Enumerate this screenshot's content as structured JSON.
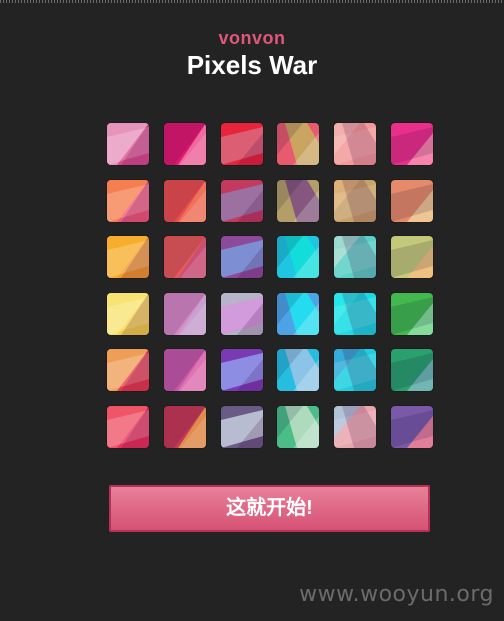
{
  "header": {
    "brand": "vonvon",
    "title": "Pixels War"
  },
  "grid": {
    "rows": 6,
    "cols": 6,
    "tiles": [
      [
        "#d94d8e",
        "#e9a1c4"
      ],
      [
        "#e3196f",
        "#f07aa8"
      ],
      [
        "#e8233a",
        "#c8203e"
      ],
      [
        "#e85a6e",
        "#c4b15f"
      ],
      [
        "#f49a9a",
        "#f5b3ad"
      ],
      [
        "#ea2f8b",
        "#f55c8c"
      ],
      [
        "#f2597a",
        "#f6864a"
      ],
      [
        "#ea4e4e",
        "#f07a5e"
      ],
      [
        "#c23a5e",
        "#6b3a85"
      ],
      [
        "#b49e67",
        "#7c4a82"
      ],
      [
        "#c7a26a",
        "#e2b47a"
      ],
      [
        "#e58a6a",
        "#e9b56a"
      ],
      [
        "#f59a2c",
        "#f7b22e"
      ],
      [
        "#e85a5a",
        "#c44e7a"
      ],
      [
        "#8e4a9a",
        "#3f68c8"
      ],
      [
        "#1fc6e2",
        "#10e0d8"
      ],
      [
        "#5bd0c8",
        "#a7dcd0"
      ],
      [
        "#c3c87a",
        "#f0a448"
      ],
      [
        "#f5d24a",
        "#f8e879"
      ],
      [
        "#d88ac4",
        "#c4a4d2"
      ],
      [
        "#b7b3c9",
        "#c26ad0"
      ],
      [
        "#4ea3e6",
        "#1de5f0"
      ],
      [
        "#18dbe5",
        "#29e9ea"
      ],
      [
        "#42b84e",
        "#5bd07a"
      ],
      [
        "#e83a4a",
        "#f0b05a"
      ],
      [
        "#c85aa8",
        "#e27ab4"
      ],
      [
        "#7a3ab4",
        "#5e6ae0"
      ],
      [
        "#27bde0",
        "#9ec6e6"
      ],
      [
        "#1fcfe0",
        "#3aa6d8"
      ],
      [
        "#2aa06e",
        "#3c9aa0"
      ],
      [
        "#ea3058",
        "#f05a6a"
      ],
      [
        "#c83a56",
        "#e59a4a"
      ],
      [
        "#6a5a86",
        "#a3b0c8"
      ],
      [
        "#4bbd88",
        "#bfe0c8"
      ],
      [
        "#e8a6ae",
        "#a7c8e0"
      ],
      [
        "#7a5aa8",
        "#e84a6a"
      ]
    ]
  },
  "actions": {
    "start_label": "这就开始!"
  },
  "watermark": "www.wooyun.org"
}
